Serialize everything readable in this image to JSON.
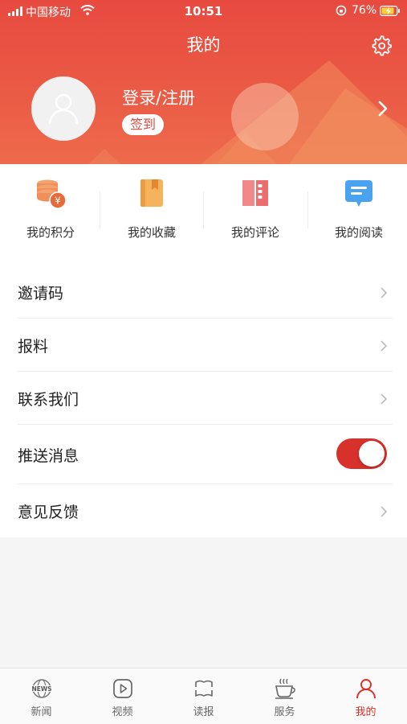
{
  "status_bar": {
    "carrier": "中国移动",
    "time": "10:51",
    "battery": "76%"
  },
  "header": {
    "title": "我的",
    "login": "登录/注册",
    "checkin": "签到"
  },
  "quick_links": [
    {
      "label": "我的积分",
      "icon": "coins-icon"
    },
    {
      "label": "我的收藏",
      "icon": "bookmark-icon"
    },
    {
      "label": "我的评论",
      "icon": "comment-book-icon"
    },
    {
      "label": "我的阅读",
      "icon": "message-icon"
    }
  ],
  "menu": [
    {
      "label": "邀请码"
    },
    {
      "label": "报料"
    },
    {
      "label": "联系我们"
    },
    {
      "label": "推送消息",
      "toggle": true
    },
    {
      "label": "意见反馈"
    }
  ],
  "tabs": [
    {
      "label": "新闻",
      "icon": "globe-news-icon"
    },
    {
      "label": "视频",
      "icon": "video-play-icon"
    },
    {
      "label": "读报",
      "icon": "newspaper-icon"
    },
    {
      "label": "服务",
      "icon": "coffee-icon"
    },
    {
      "label": "我的",
      "icon": "user-icon",
      "active": true
    }
  ],
  "colors": {
    "accent": "#d8302a",
    "header": "#e84a3f"
  }
}
